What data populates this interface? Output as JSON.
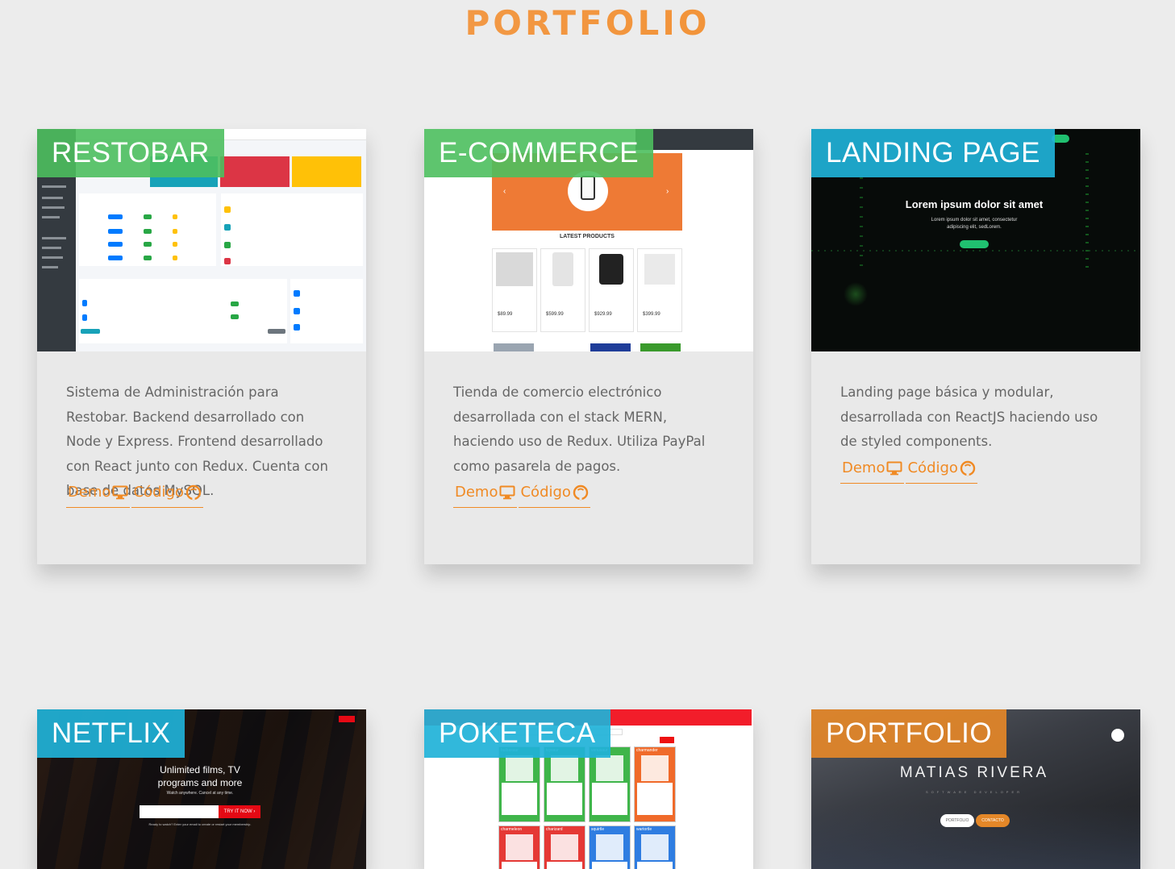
{
  "section": {
    "title": "PORTFOLIO"
  },
  "projects": [
    {
      "tag": "RESTOBAR",
      "description": "Sistema de Administración para Restobar. Backend desarrollado con Node y Express. Frontend desarrollado con React junto con Redux. Cuenta con base de datos MySQL.",
      "demo_label": "Demo",
      "code_label": "Código"
    },
    {
      "tag": "E-COMMERCE",
      "description": "Tienda de comercio electrónico desarrollada con el stack MERN, haciendo uso de Redux. Utiliza PayPal como pasarela de pagos.",
      "demo_label": "Demo",
      "code_label": "Código",
      "screenshot": {
        "heading": "LATEST PRODUCTS",
        "prices": [
          "$89.99",
          "$599.99",
          "$929.99",
          "$399.99"
        ]
      }
    },
    {
      "tag": "LANDING PAGE",
      "description": "Landing page básica y modular, desarrollada con ReactJS haciendo uso de styled components.",
      "demo_label": "Demo",
      "code_label": "Código",
      "screenshot": {
        "headline": "Lorem ipsum dolor sit amet",
        "sub1": "Lorem ipsum dolor sit amet, consectetur",
        "sub2": "adipiscing elit, sedLorem."
      }
    },
    {
      "tag": "NETFLIX",
      "screenshot": {
        "headline1": "Unlimited films, TV",
        "headline2": "programs and more",
        "sub": "Watch anywhere. Cancel at any time.",
        "cta": "TRY IT NOW",
        "footnote": "Ready to watch? Enter your email to create or restart your membership."
      }
    },
    {
      "tag": "POKETECA",
      "screenshot": {
        "cards": [
          "bulbasaur",
          "ivysaur",
          "venusaur",
          "charmander",
          "charmeleon",
          "charizard",
          "squirtle",
          "wartortle"
        ]
      }
    },
    {
      "tag": "PORTFOLIO",
      "screenshot": {
        "name": "MATIAS RIVERA",
        "role": "SOFTWARE DEVELOPER",
        "btn1": "PORTFOLIO",
        "btn2": "CONTACTO"
      }
    }
  ],
  "colors": {
    "accent": "#f08a24",
    "green": "#4cbf5e",
    "teal": "#20b2d8",
    "orange": "#e48728"
  }
}
